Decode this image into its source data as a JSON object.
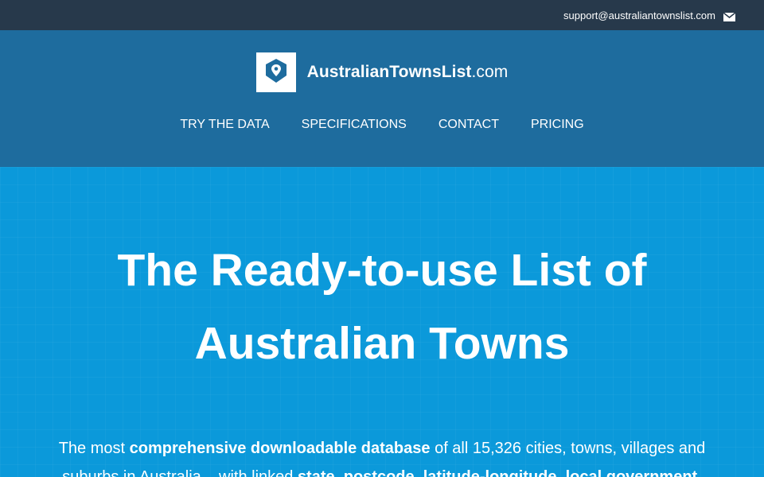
{
  "topbar": {
    "email": "support@australiantownslist.com",
    "email_icon": "mail-icon"
  },
  "brand": {
    "logo_icon": "location-pin-icon",
    "name_bold": "AustralianTownsList",
    "name_suffix": ".com"
  },
  "nav": {
    "items": [
      "TRY THE DATA",
      "SPECIFICATIONS",
      "CONTACT",
      "PRICING"
    ]
  },
  "hero": {
    "title_line1": "The Ready-to-use List of",
    "title_line2": "Australian Towns",
    "desc": {
      "p1": "The most ",
      "b1": "comprehensive downloadable database",
      "p2": " of all 15,326 cities, towns, villages and suburbs in Australia – with linked ",
      "b2": "state, postcode, latitude-longitude, local government,"
    }
  },
  "colors": {
    "topbar": "#27394b",
    "header": "#1e6c9e",
    "hero": "#0b99da",
    "text": "#ffffff"
  }
}
